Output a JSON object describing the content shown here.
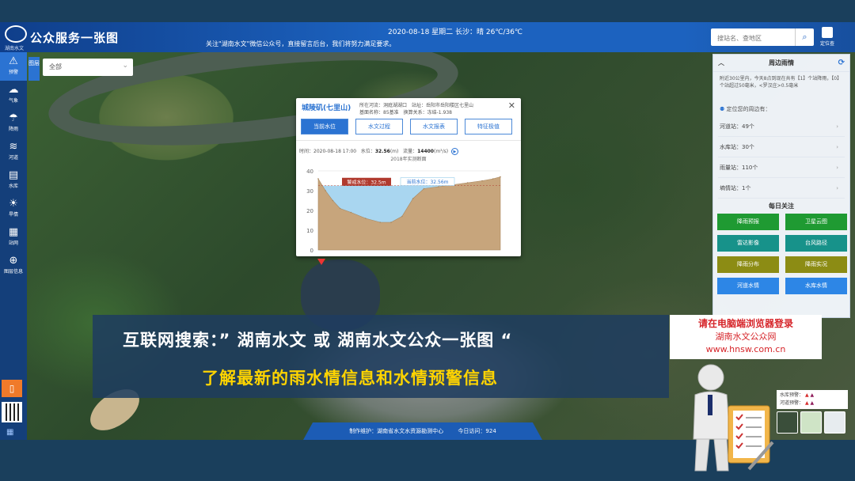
{
  "header": {
    "logo_caption": "湖南水文",
    "title": "公众服务一张图",
    "date_weather": "2020-08-18 星期二 长沙：晴 26℃/36℃",
    "notice": "关注\"湖南水文\"微信公众号，直接留言后台，我们将努力满足要求。",
    "search_placeholder": "搜站名、查地区",
    "locate_label": "定位查"
  },
  "sidebar": {
    "items": [
      {
        "label": "预警",
        "icon": "warning-icon"
      },
      {
        "label": "气象",
        "icon": "weather-icon"
      },
      {
        "label": "降雨",
        "icon": "rain-icon"
      },
      {
        "label": "河道",
        "icon": "river-icon"
      },
      {
        "label": "水库",
        "icon": "reservoir-icon"
      },
      {
        "label": "旱情",
        "icon": "drought-icon"
      },
      {
        "label": "站网",
        "icon": "station-icon"
      },
      {
        "label": "图层信息",
        "icon": "globe-icon"
      }
    ],
    "layer_tab": "图层",
    "dropdown_value": "全部"
  },
  "popup": {
    "station": "城陵矶(七里山)",
    "meta_line1": "所在河流：洞庭湖湖口　站址：岳阳市岳阳楼区七里山",
    "meta_line2": "基面名称：85基准　换算关系：冻结-1.938",
    "tabs": [
      "当前水位",
      "水文过程",
      "水文报表",
      "特征极值"
    ],
    "time_label": "时间：",
    "time_value": "2020-08-18 17:00",
    "level_label": "水位：",
    "level_value": "32.56",
    "level_unit": "(m)",
    "flow_label": "流量：",
    "flow_value": "14400",
    "flow_unit": "(m³/s)",
    "caption": "2018年实测断面",
    "warning_label": "警戒水位：32.5m",
    "current_label": "当前水位：32.56m"
  },
  "chart_data": {
    "type": "area",
    "title": "2018年实测断面",
    "ylim": [
      0,
      40
    ],
    "yticks": [
      0,
      10,
      20,
      30,
      40
    ],
    "warning_level": 32.5,
    "current_level": 32.56,
    "profile": [
      [
        0,
        36
      ],
      [
        4,
        30
      ],
      [
        8,
        25
      ],
      [
        12,
        21
      ],
      [
        18,
        19
      ],
      [
        26,
        16
      ],
      [
        34,
        14
      ],
      [
        40,
        14
      ],
      [
        46,
        17
      ],
      [
        52,
        26
      ],
      [
        58,
        31
      ],
      [
        66,
        32
      ],
      [
        74,
        33
      ],
      [
        82,
        34
      ],
      [
        90,
        35
      ],
      [
        96,
        36
      ],
      [
        100,
        37
      ]
    ]
  },
  "right_panel": {
    "title": "周边雨情",
    "desc": "附近30公里内，今天8点到现在共有【1】个站降雨，【0】个站超过50毫米，<罗汉庄>0.5毫米",
    "locate_text": "定位您的周边有：",
    "stats": [
      {
        "label": "河道站：49个"
      },
      {
        "label": "水库站：30个"
      },
      {
        "label": "雨量站：110个"
      },
      {
        "label": "墒情站：1个"
      }
    ],
    "daily_title": "每日关注",
    "buttons": [
      {
        "label": "降雨预报",
        "color": "#1f9a32"
      },
      {
        "label": "卫星云图",
        "color": "#1f9a32"
      },
      {
        "label": "雷达影像",
        "color": "#17928a"
      },
      {
        "label": "台风路径",
        "color": "#17928a"
      },
      {
        "label": "降雨分布",
        "color": "#8c8c14"
      },
      {
        "label": "降雨实况",
        "color": "#8c8c14"
      },
      {
        "label": "河道水情",
        "color": "#2d86e6"
      },
      {
        "label": "水库水情",
        "color": "#2d86e6"
      }
    ]
  },
  "banner": {
    "line1": "互联网搜索：” 湖南水文  或  湖南水文公众一张图 “",
    "line2": "了解最新的雨水情信息和水情预警信息"
  },
  "callout": {
    "line1": "请在电脑端浏览器登录",
    "line2": "湖南水文公众网",
    "line3": "www.hnsw.com.cn"
  },
  "legend": {
    "reservoir": "水库预警：",
    "river": "河道预警："
  },
  "footer": {
    "maintainer": "制作维护：湖南省水文水资源勘测中心",
    "visits": "今日访问：924"
  }
}
